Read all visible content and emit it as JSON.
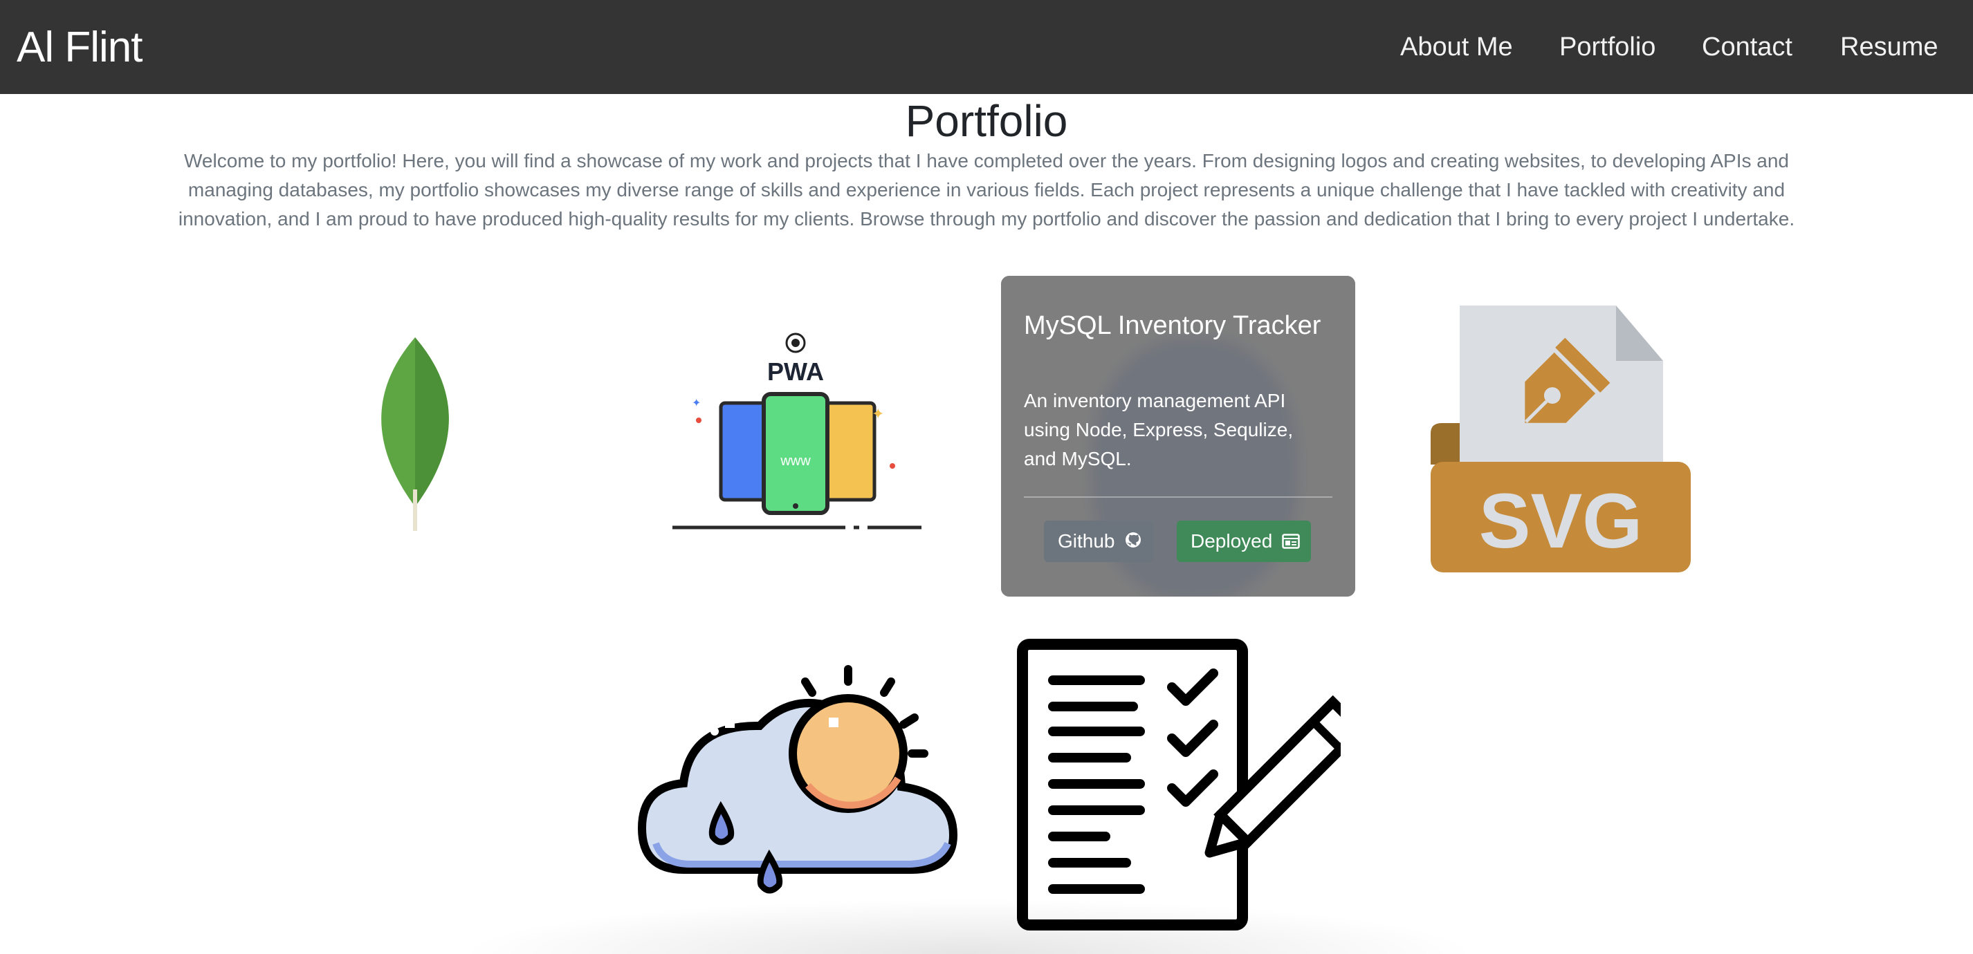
{
  "nav": {
    "brand": "Al Flint",
    "links": [
      "About Me",
      "Portfolio",
      "Contact",
      "Resume"
    ]
  },
  "main": {
    "title": "Portfolio",
    "intro": "Welcome to my portfolio! Here, you will find a showcase of my work and projects that I have completed over the years. From designing logos and creating websites, to developing APIs and managing databases, my portfolio showcases my diverse range of skills and experience in various fields. Each project represents a unique challenge that I have tackled with creativity and innovation, and I am proud to have produced high-quality results for my clients. Browse through my portfolio and discover the passion and dedication that I bring to every project I undertake."
  },
  "projects": [
    {
      "icon": "mongodb-leaf-icon"
    },
    {
      "icon": "pwa-devices-icon",
      "label": "PWA",
      "screen_text": "www"
    },
    {
      "icon": "mysql-inventory-icon",
      "title": "MySQL Inventory Tracker",
      "description": "An inventory management API using Node, Express, Sequlize, and MySQL.",
      "github_label": "Github",
      "deployed_label": "Deployed"
    },
    {
      "icon": "svg-file-icon",
      "label": "SVG"
    },
    {
      "icon": "weather-cloud-sun-icon"
    },
    {
      "icon": "checklist-pencil-icon"
    }
  ],
  "colors": {
    "navbar": "#343434",
    "github_button": "#6c757d",
    "deployed_button": "#3f8a58",
    "svg_orange": "#c58b3a"
  }
}
